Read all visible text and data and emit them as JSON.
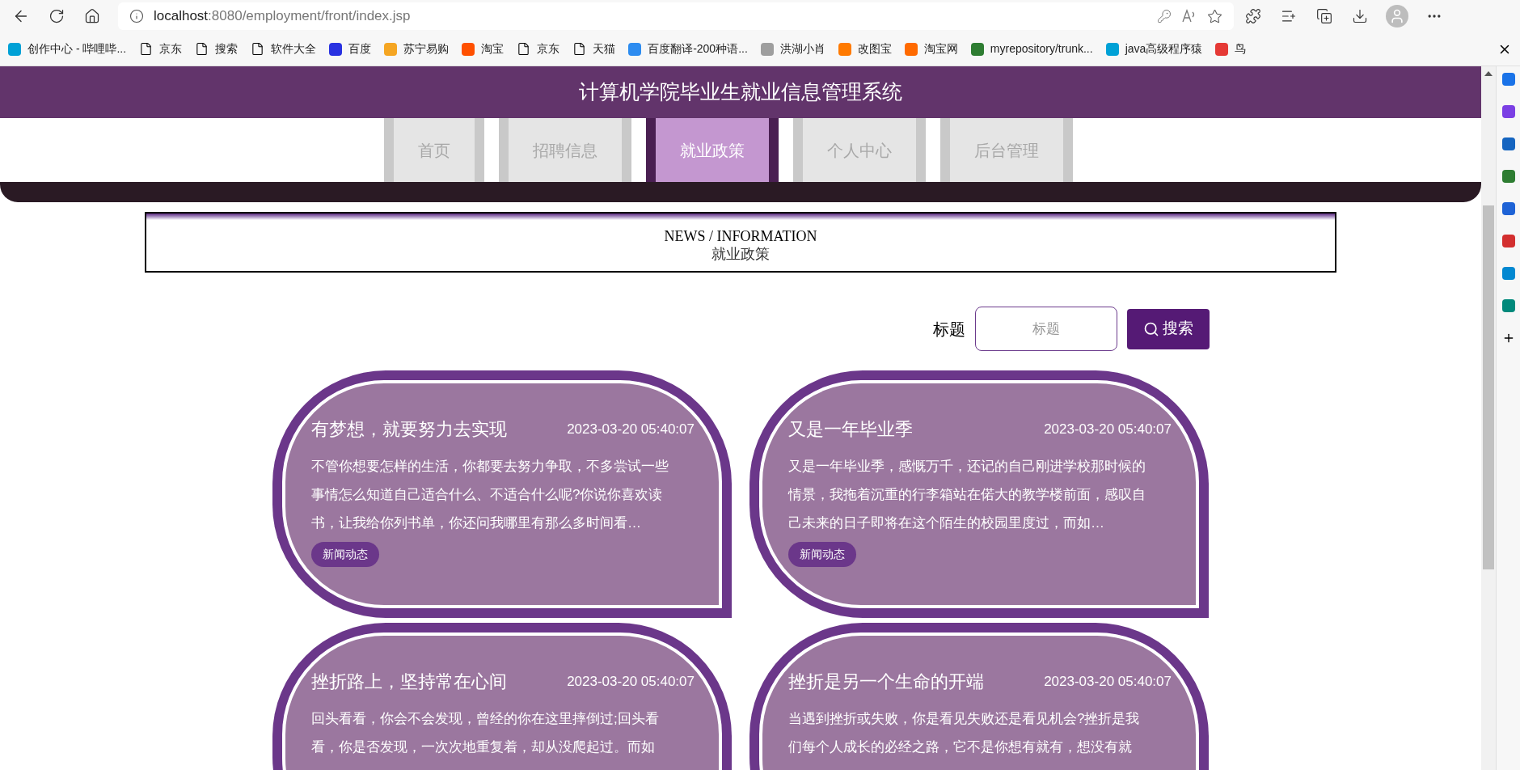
{
  "browser": {
    "url_host": "localhost",
    "url_path": ":8080/employment/front/index.jsp",
    "bookmarks": [
      {
        "label": "创作中心 - 哔哩哔...",
        "kind": "logo",
        "color": "#00a1d6"
      },
      {
        "label": "京东",
        "kind": "file"
      },
      {
        "label": "搜索",
        "kind": "file"
      },
      {
        "label": "软件大全",
        "kind": "file"
      },
      {
        "label": "百度",
        "kind": "logo",
        "color": "#2932e1"
      },
      {
        "label": "苏宁易购",
        "kind": "logo",
        "color": "#f5a623"
      },
      {
        "label": "淘宝",
        "kind": "logo",
        "color": "#ff5000"
      },
      {
        "label": "京东",
        "kind": "file"
      },
      {
        "label": "天猫",
        "kind": "file"
      },
      {
        "label": "百度翻译-200种语...",
        "kind": "logo",
        "color": "#2d8cf0"
      },
      {
        "label": "洪湖小肖",
        "kind": "logo",
        "color": "#9e9e9e"
      },
      {
        "label": "改图宝",
        "kind": "logo",
        "color": "#ff7a00"
      },
      {
        "label": "淘宝网",
        "kind": "logo",
        "color": "#ff6a00"
      },
      {
        "label": "myrepository/trunk...",
        "kind": "logo",
        "color": "#2e7d32"
      },
      {
        "label": "java高级程序猿",
        "kind": "logo",
        "color": "#00a1d6"
      },
      {
        "label": "鸟",
        "kind": "logo",
        "color": "#e53935"
      }
    ]
  },
  "site": {
    "title": "计算机学院毕业生就业信息管理系统",
    "nav": [
      {
        "label": "首页",
        "selected": false
      },
      {
        "label": "招聘信息",
        "selected": false
      },
      {
        "label": "就业政策",
        "selected": true
      },
      {
        "label": "个人中心",
        "selected": false
      },
      {
        "label": "后台管理",
        "selected": false
      }
    ],
    "section": {
      "heading": "NEWS / INFORMATION",
      "subheading": "就业政策"
    },
    "search": {
      "label": "标题",
      "placeholder": "标题",
      "button": "搜索"
    },
    "articles": [
      {
        "title": "有梦想，就要努力去实现",
        "date": "2023-03-20 05:40:07",
        "excerpt": "不管你想要怎样的生活，你都要去努力争取，不多尝试一些事情怎么知道自己适合什么、不适合什么呢?你说你喜欢读书，让我给你列书单，你还问我哪里有那么多时间看…",
        "tag": "新闻动态"
      },
      {
        "title": "又是一年毕业季",
        "date": "2023-03-20 05:40:07",
        "excerpt": "又是一年毕业季，感慨万千，还记的自己刚进学校那时候的情景，我拖着沉重的行李箱站在偌大的教学楼前面，感叹自己未来的日子即将在这个陌生的校园里度过，而如…",
        "tag": "新闻动态"
      },
      {
        "title": "挫折路上，坚持常在心间",
        "date": "2023-03-20 05:40:07",
        "excerpt": "回头看看，你会不会发现，曾经的你在这里摔倒过;回头看看，你是否发现，一次次地重复着，却从没爬起过。而如"
      },
      {
        "title": "挫折是另一个生命的开端",
        "date": "2023-03-20 05:40:07",
        "excerpt": "当遇到挫折或失败，你是看见失败还是看见机会?挫折是我们每个人成长的必经之路，它不是你想有就有，想没有就"
      }
    ]
  }
}
